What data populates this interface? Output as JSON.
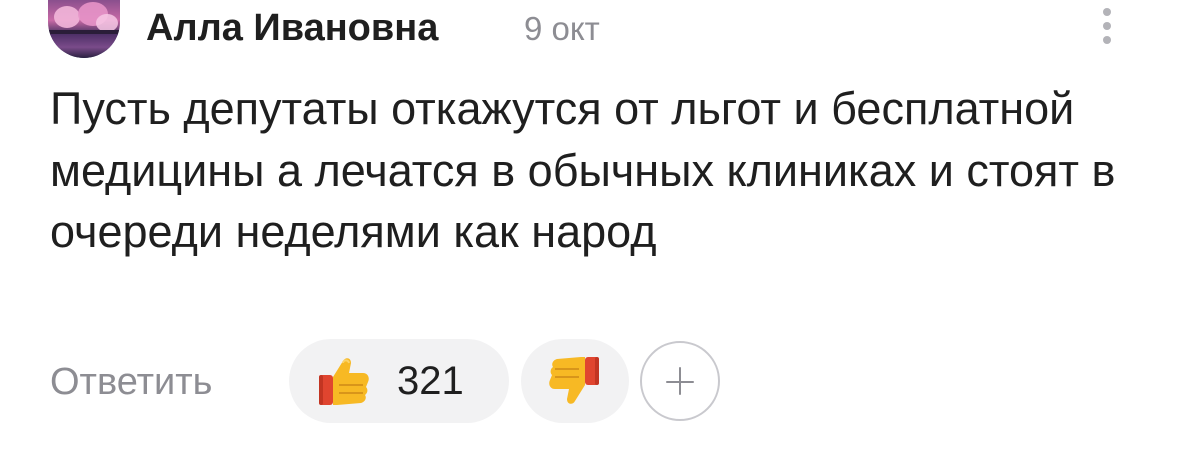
{
  "comment": {
    "author": "Алла Ивановна",
    "date": "9 окт",
    "text": "Пусть депутаты откажутся от льгот и бесплатной медицины а лечатся в обычных клиниках и стоят в очереди неделями как народ"
  },
  "actions": {
    "reply_label": "Ответить",
    "like_count": "321",
    "like_icon": "thumbs-up-icon",
    "dislike_icon": "thumbs-down-icon",
    "add_reaction_icon": "plus-icon",
    "more_icon": "more-vertical-icon"
  },
  "colors": {
    "text_primary": "#1f1f1f",
    "text_secondary": "#8d8d93",
    "pill_background": "#f2f2f3",
    "thumb_yellow": "#f7b924",
    "cuff_red": "#e0452f"
  }
}
